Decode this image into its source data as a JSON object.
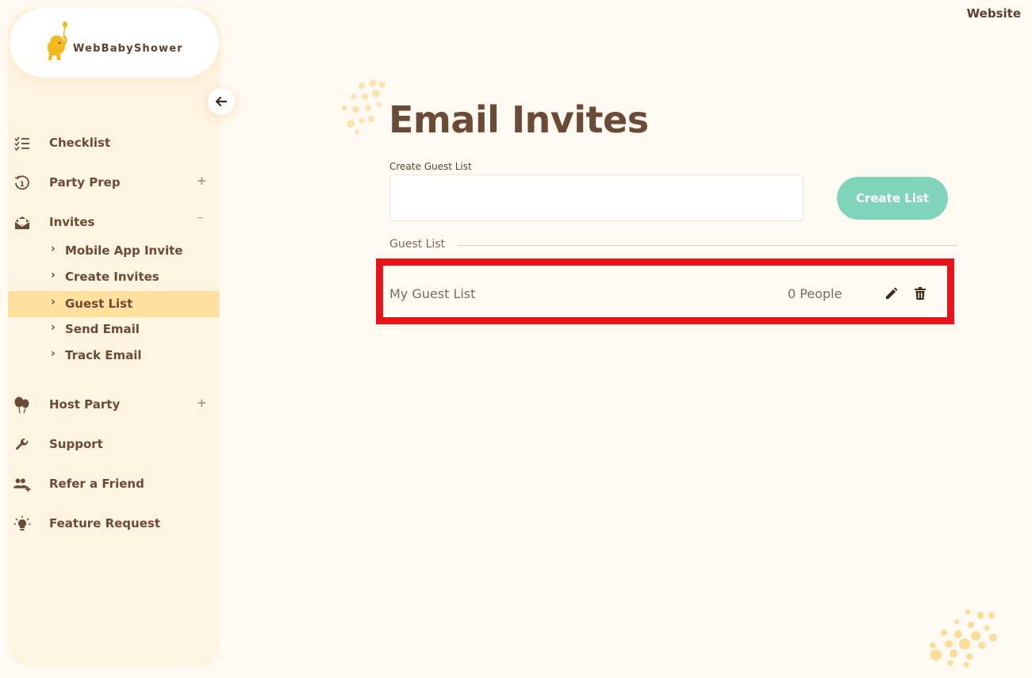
{
  "brand": {
    "name": "WebBabyShower",
    "logo_icon": "elephant-balloon-logo"
  },
  "header": {
    "website_link": "Website"
  },
  "sidebar": {
    "collapse_icon": "arrow-left-icon",
    "items": [
      {
        "label": "Checklist",
        "icon": "checklist-icon"
      },
      {
        "label": "Party Prep",
        "icon": "history-icon",
        "toggle": "+"
      },
      {
        "label": "Invites",
        "icon": "envelope-open-icon",
        "toggle": "−"
      },
      {
        "label": "Host Party",
        "icon": "balloons-icon",
        "toggle": "+"
      },
      {
        "label": "Support",
        "icon": "wrench-icon"
      },
      {
        "label": "Refer a Friend",
        "icon": "add-people-icon"
      },
      {
        "label": "Feature Request",
        "icon": "lightbulb-icon"
      }
    ],
    "invites_subitems": [
      {
        "label": "Mobile App Invite"
      },
      {
        "label": "Create Invites"
      },
      {
        "label": "Guest List",
        "active": true
      },
      {
        "label": "Send Email"
      },
      {
        "label": "Track Email"
      }
    ]
  },
  "main": {
    "title": "Email Invites",
    "create_field_label": "Create Guest List",
    "create_field_value": "",
    "create_button": "Create List",
    "section_label": "Guest List",
    "guest_lists": [
      {
        "name": "My Guest List",
        "count": "0 People"
      }
    ]
  },
  "colors": {
    "brown": "#6b4a36",
    "mint_button": "#7fd4bb",
    "active_highlight": "#ffe09c",
    "sidebar_bg": "#fff4e2",
    "page_bg": "#fffaf1",
    "highlight_red": "#e8141c",
    "accent_yellow": "#f2b81c"
  }
}
